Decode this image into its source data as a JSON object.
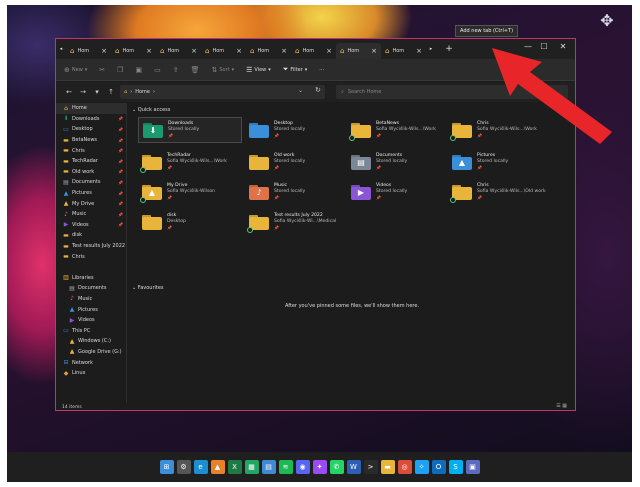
{
  "tooltip": "Add new tab (Ctrl+T)",
  "tabs": [
    {
      "label": "Hom",
      "active": false
    },
    {
      "label": "Hom",
      "active": false
    },
    {
      "label": "Hom",
      "active": false
    },
    {
      "label": "Hom",
      "active": false
    },
    {
      "label": "Hom",
      "active": false
    },
    {
      "label": "Hom",
      "active": false
    },
    {
      "label": "Hom",
      "active": true
    },
    {
      "label": "Hom",
      "active": false
    }
  ],
  "new_tab_label": "+",
  "window_controls": {
    "minimize": "—",
    "maximize": "☐",
    "close": "✕"
  },
  "toolbar": {
    "new": "New",
    "sort": "Sort",
    "view": "View",
    "filter": "Filter",
    "more": "···"
  },
  "address": {
    "path": "Home"
  },
  "search": {
    "placeholder": "Search Home"
  },
  "sidebar": {
    "items": [
      {
        "label": "Home",
        "icon": "home-icon",
        "pinned": false,
        "selected": true
      },
      {
        "label": "Downloads",
        "icon": "download-icon",
        "pinned": true
      },
      {
        "label": "Desktop",
        "icon": "desktop-icon",
        "pinned": true
      },
      {
        "label": "BetaNews",
        "icon": "folder-icon",
        "pinned": true
      },
      {
        "label": "Chris",
        "icon": "folder-icon",
        "pinned": true
      },
      {
        "label": "TechRadar",
        "icon": "folder-icon",
        "pinned": true
      },
      {
        "label": "Old work",
        "icon": "folder-icon",
        "pinned": true
      },
      {
        "label": "Documents",
        "icon": "documents-icon",
        "pinned": true
      },
      {
        "label": "Pictures",
        "icon": "pictures-icon",
        "pinned": true
      },
      {
        "label": "My Drive",
        "icon": "drive-icon",
        "pinned": true
      },
      {
        "label": "Music",
        "icon": "music-icon",
        "pinned": true
      },
      {
        "label": "Videos",
        "icon": "videos-icon",
        "pinned": true
      },
      {
        "label": "disk",
        "icon": "folder-icon",
        "pinned": false
      },
      {
        "label": "Test results July 2022",
        "icon": "folder-icon",
        "pinned": false
      },
      {
        "label": "Chris",
        "icon": "folder-icon",
        "pinned": false
      },
      {
        "label": "",
        "icon": "",
        "pinned": false
      },
      {
        "label": "Libraries",
        "icon": "libraries-icon",
        "pinned": false
      },
      {
        "label": "Documents",
        "icon": "documents-icon",
        "pinned": false,
        "indent": true
      },
      {
        "label": "Music",
        "icon": "music-icon",
        "pinned": false,
        "indent": true
      },
      {
        "label": "Pictures",
        "icon": "pictures-icon",
        "pinned": false,
        "indent": true
      },
      {
        "label": "Videos",
        "icon": "videos-icon",
        "pinned": false,
        "indent": true
      },
      {
        "label": "This PC",
        "icon": "pc-icon",
        "pinned": false
      },
      {
        "label": "Windows (C:)",
        "icon": "drive-icon",
        "pinned": false,
        "indent": true
      },
      {
        "label": "Google Drive (G:)",
        "icon": "drive-icon",
        "pinned": false,
        "indent": true
      },
      {
        "label": "Network",
        "icon": "network-icon",
        "pinned": false
      },
      {
        "label": "Linux",
        "icon": "linux-icon",
        "pinned": false
      }
    ]
  },
  "quick_access": {
    "header": "Quick access",
    "items": [
      {
        "name": "Downloads",
        "sub": "Stored locally",
        "color": "#1a9a6e",
        "glyph": "⬇",
        "selected": true,
        "synced": false
      },
      {
        "name": "Desktop",
        "sub": "Stored locally",
        "color": "#3b8fd9",
        "glyph": "",
        "selected": false,
        "synced": false
      },
      {
        "name": "BetaNews",
        "sub": "Sofia Wyciślik-Wils...\\Work",
        "color": "#e8b53a",
        "glyph": "",
        "selected": false,
        "synced": true
      },
      {
        "name": "Chris",
        "sub": "Sofia Wyciślik-Wils...\\Work",
        "color": "#e8b53a",
        "glyph": "",
        "selected": false,
        "synced": true
      },
      {
        "name": "TechRadar",
        "sub": "Sofia Wyciślik-Wils...\\Work",
        "color": "#e8b53a",
        "glyph": "",
        "selected": false,
        "synced": true
      },
      {
        "name": "Old work",
        "sub": "Stored locally",
        "color": "#e8b53a",
        "glyph": "",
        "selected": false,
        "synced": false
      },
      {
        "name": "Documents",
        "sub": "Stored locally",
        "color": "#7a8796",
        "glyph": "▤",
        "selected": false,
        "synced": false
      },
      {
        "name": "Pictures",
        "sub": "Stored locally",
        "color": "#3b8fd9",
        "glyph": "▲",
        "selected": false,
        "synced": false
      },
      {
        "name": "My Drive",
        "sub": "Sofia Wyciślik-Wilson",
        "color": "#e8b53a",
        "glyph": "▲",
        "selected": false,
        "synced": true
      },
      {
        "name": "Music",
        "sub": "Stored locally",
        "color": "#e0724a",
        "glyph": "♪",
        "selected": false,
        "synced": false
      },
      {
        "name": "Videos",
        "sub": "Stored locally",
        "color": "#8a56d6",
        "glyph": "▶",
        "selected": false,
        "synced": false
      },
      {
        "name": "Chris",
        "sub": "Sofia Wyciślik-Wils...\\Old work",
        "color": "#e8b53a",
        "glyph": "",
        "selected": false,
        "synced": true
      },
      {
        "name": "disk",
        "sub": "Desktop",
        "color": "#e8b53a",
        "glyph": "",
        "selected": false,
        "synced": false
      },
      {
        "name": "Test results July 2022",
        "sub": "Sofia Wyciślik-Wi...\\Medical",
        "color": "#e8b53a",
        "glyph": "",
        "selected": false,
        "synced": true
      }
    ]
  },
  "favourites": {
    "header": "Favourites",
    "empty_message": "After you've pinned some files, we'll show them here."
  },
  "status": {
    "items": "14 items"
  },
  "taskbar": {
    "apps": [
      {
        "name": "windows-start-icon",
        "color": "#3b8fd9",
        "glyph": "⊞"
      },
      {
        "name": "settings-icon",
        "color": "#555",
        "glyph": "⚙"
      },
      {
        "name": "edge-icon",
        "color": "#1d8fd0",
        "glyph": "e"
      },
      {
        "name": "vlc-icon",
        "color": "#e8822a",
        "glyph": "▲"
      },
      {
        "name": "excel-icon",
        "color": "#1e7a43",
        "glyph": "X"
      },
      {
        "name": "sheets-icon",
        "color": "#23a566",
        "glyph": "▦"
      },
      {
        "name": "notepad-icon",
        "color": "#3f8bd0",
        "glyph": "▤"
      },
      {
        "name": "spotify-icon",
        "color": "#1db954",
        "glyph": "≋"
      },
      {
        "name": "discord-icon",
        "color": "#5865f2",
        "glyph": "◉"
      },
      {
        "name": "messenger-icon",
        "color": "#9a4cf0",
        "glyph": "✦"
      },
      {
        "name": "whatsapp-icon",
        "color": "#25d366",
        "glyph": "✆"
      },
      {
        "name": "word-icon",
        "color": "#2b5fb4",
        "glyph": "W"
      },
      {
        "name": "terminal-icon",
        "color": "#2a2a2a",
        "glyph": ">"
      },
      {
        "name": "file-explorer-icon",
        "color": "#e8b53a",
        "glyph": "▬"
      },
      {
        "name": "chrome-icon",
        "color": "#dd4b39",
        "glyph": "◎"
      },
      {
        "name": "twitter-icon",
        "color": "#1da1f2",
        "glyph": "✧"
      },
      {
        "name": "outlook-icon",
        "color": "#0f6cbd",
        "glyph": "O"
      },
      {
        "name": "skype-icon",
        "color": "#00aff0",
        "glyph": "S"
      },
      {
        "name": "photos-icon",
        "color": "#5c6bc0",
        "glyph": "▣"
      }
    ]
  },
  "colors": {
    "accent": "#c2346a",
    "arrow": "#e8262a",
    "folder": "#e8b53a"
  }
}
